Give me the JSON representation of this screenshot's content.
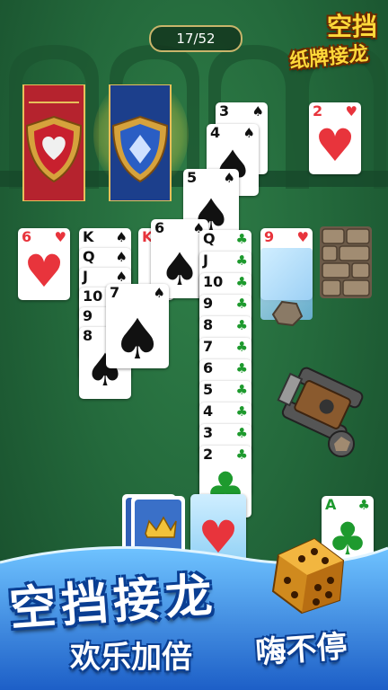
{
  "game": {
    "title_line1": "空挡",
    "title_line2": "纸牌接龙",
    "progress_label": "17/52"
  },
  "foundations": [
    {
      "suit": "heart-icon",
      "color": "#e8343c"
    },
    {
      "suit": "diamond-icon",
      "color": "#2a5ec4"
    }
  ],
  "cards": {
    "three_spade": {
      "rank": "3",
      "suit": "♠"
    },
    "four_spade": {
      "rank": "4",
      "suit": "♠"
    },
    "five_spade": {
      "rank": "5",
      "suit": "♠"
    },
    "six_spade": {
      "rank": "6",
      "suit": "♠"
    },
    "seven_spade": {
      "rank": "7",
      "suit": "♠"
    },
    "two_heart": {
      "rank": "2",
      "suit": "♥"
    },
    "six_heart": {
      "rank": "6",
      "suit": "♥"
    },
    "nine_heart": {
      "rank": "9",
      "suit": "♥"
    },
    "ace_club": {
      "rank": "A",
      "suit": "♣"
    },
    "spade_col": [
      {
        "rank": "K",
        "suit": "♠"
      },
      {
        "rank": "Q",
        "suit": "♠"
      },
      {
        "rank": "J",
        "suit": "♠"
      },
      {
        "rank": "10",
        "suit": "♠"
      },
      {
        "rank": "9",
        "suit": "♠"
      },
      {
        "rank": "8",
        "suit": "♠"
      }
    ],
    "k_red_rank": "K",
    "club_col": [
      {
        "rank": "2",
        "suit": "♣"
      },
      {
        "rank": "3",
        "suit": "♣"
      },
      {
        "rank": "4",
        "suit": "♣"
      },
      {
        "rank": "5",
        "suit": "♣"
      },
      {
        "rank": "6",
        "suit": "♣"
      },
      {
        "rank": "7",
        "suit": "♣"
      },
      {
        "rank": "8",
        "suit": "♣"
      },
      {
        "rank": "9",
        "suit": "♣"
      },
      {
        "rank": "10",
        "suit": "♣"
      },
      {
        "rank": "J",
        "suit": "♣"
      },
      {
        "rank": "Q",
        "suit": "♣"
      }
    ]
  },
  "promo": {
    "headline": "空挡接龙",
    "slogan_left": "欢乐加倍",
    "slogan_right": "嗨不停"
  }
}
